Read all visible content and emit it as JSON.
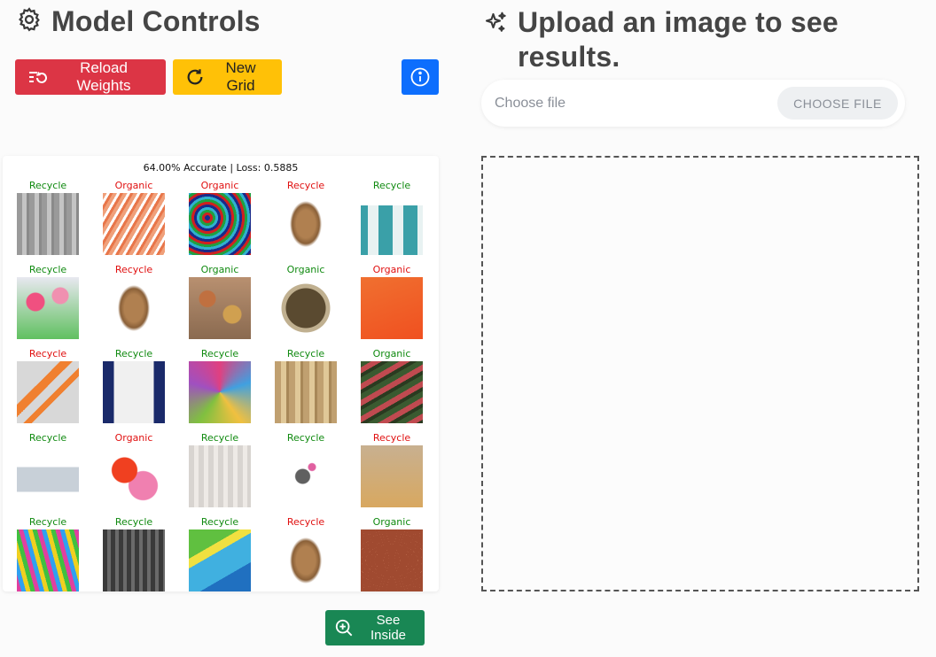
{
  "left": {
    "title": "Model Controls",
    "reload_label": "Reload Weights",
    "newgrid_label": "New Grid",
    "see_inside_label": "See Inside",
    "grid_title": "64.00% Accurate | Loss: 0.5885",
    "label_colors": {
      "green": "#108a10",
      "red": "#e01010"
    },
    "grid": [
      {
        "label": "Recycle",
        "color": "green",
        "thumb": "curtain-gray"
      },
      {
        "label": "Organic",
        "color": "red",
        "thumb": "straws-orange"
      },
      {
        "label": "Organic",
        "color": "red",
        "thumb": "straws-multicolor"
      },
      {
        "label": "Recycle",
        "color": "red",
        "thumb": "potato"
      },
      {
        "label": "Recycle",
        "color": "green",
        "thumb": "curtain-teal"
      },
      {
        "label": "Recycle",
        "color": "green",
        "thumb": "paper-flowers"
      },
      {
        "label": "Recycle",
        "color": "red",
        "thumb": "potato"
      },
      {
        "label": "Organic",
        "color": "green",
        "thumb": "spices"
      },
      {
        "label": "Organic",
        "color": "green",
        "thumb": "beans-bowl"
      },
      {
        "label": "Organic",
        "color": "red",
        "thumb": "straws-cup"
      },
      {
        "label": "Recycle",
        "color": "red",
        "thumb": "carrots"
      },
      {
        "label": "Recycle",
        "color": "green",
        "thumb": "curtain-navy"
      },
      {
        "label": "Recycle",
        "color": "green",
        "thumb": "tissue-paper"
      },
      {
        "label": "Recycle",
        "color": "green",
        "thumb": "curtain-gold"
      },
      {
        "label": "Organic",
        "color": "green",
        "thumb": "carrots-red"
      },
      {
        "label": "Recycle",
        "color": "green",
        "thumb": "foil-rolls"
      },
      {
        "label": "Organic",
        "color": "red",
        "thumb": "paper-fans"
      },
      {
        "label": "Recycle",
        "color": "green",
        "thumb": "curtain-white"
      },
      {
        "label": "Recycle",
        "color": "green",
        "thumb": "small-objects"
      },
      {
        "label": "Recycle",
        "color": "red",
        "thumb": "grain-bag"
      },
      {
        "label": "Recycle",
        "color": "green",
        "thumb": "straws-closeup"
      },
      {
        "label": "Recycle",
        "color": "green",
        "thumb": "curtain-dark"
      },
      {
        "label": "Recycle",
        "color": "green",
        "thumb": "paper-green-blue"
      },
      {
        "label": "Recycle",
        "color": "red",
        "thumb": "potato"
      },
      {
        "label": "Organic",
        "color": "green",
        "thumb": "kidney-beans"
      }
    ]
  },
  "right": {
    "title": "Upload an image to see results.",
    "file_placeholder": "Choose file",
    "file_button": "CHOOSE FILE"
  }
}
